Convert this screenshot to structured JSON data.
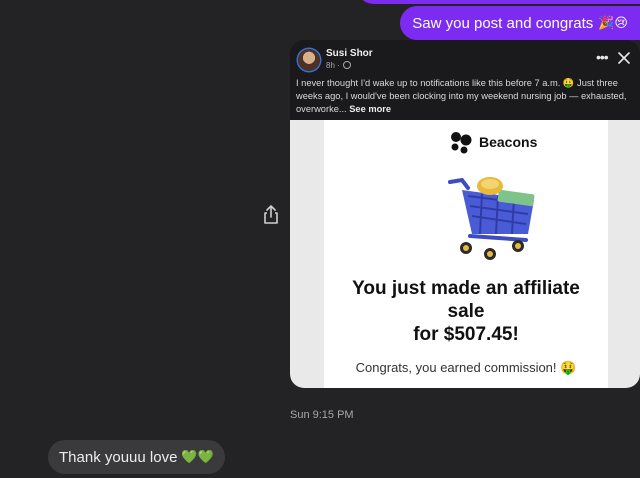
{
  "messages": {
    "sent_text": "Saw you post and congrats",
    "sent_emoji": "🎉😢",
    "timestamp": "Sun 9:15 PM",
    "received_text": "Thank youuu love",
    "received_emoji": "💚💚"
  },
  "shared_post": {
    "author": "Susi Shor",
    "time": "8h ·",
    "body": "I never thought I'd wake up to notifications like this before 7 a.m. 🤑 Just three weeks ago, I would've been clocking into my weekend nursing job — exhausted, overworke...",
    "see_more": "See more",
    "image": {
      "brand": "Beacons",
      "headline_line1": "You just made an affiliate",
      "headline_line2": "sale",
      "headline_line3": "for $507.45!",
      "subtext": "Congrats, you earned commission! 🤑"
    }
  },
  "colors": {
    "background": "#232325",
    "sent_bubble": "#7c2cf0",
    "received_bubble": "#3a3a3d",
    "card": "#1a1a1c",
    "cart_blue": "#4a5bd6"
  },
  "icons": [
    "share-icon",
    "more-options-icon",
    "close-icon",
    "globe-icon",
    "beacons-logo",
    "shopping-cart-illustration"
  ]
}
